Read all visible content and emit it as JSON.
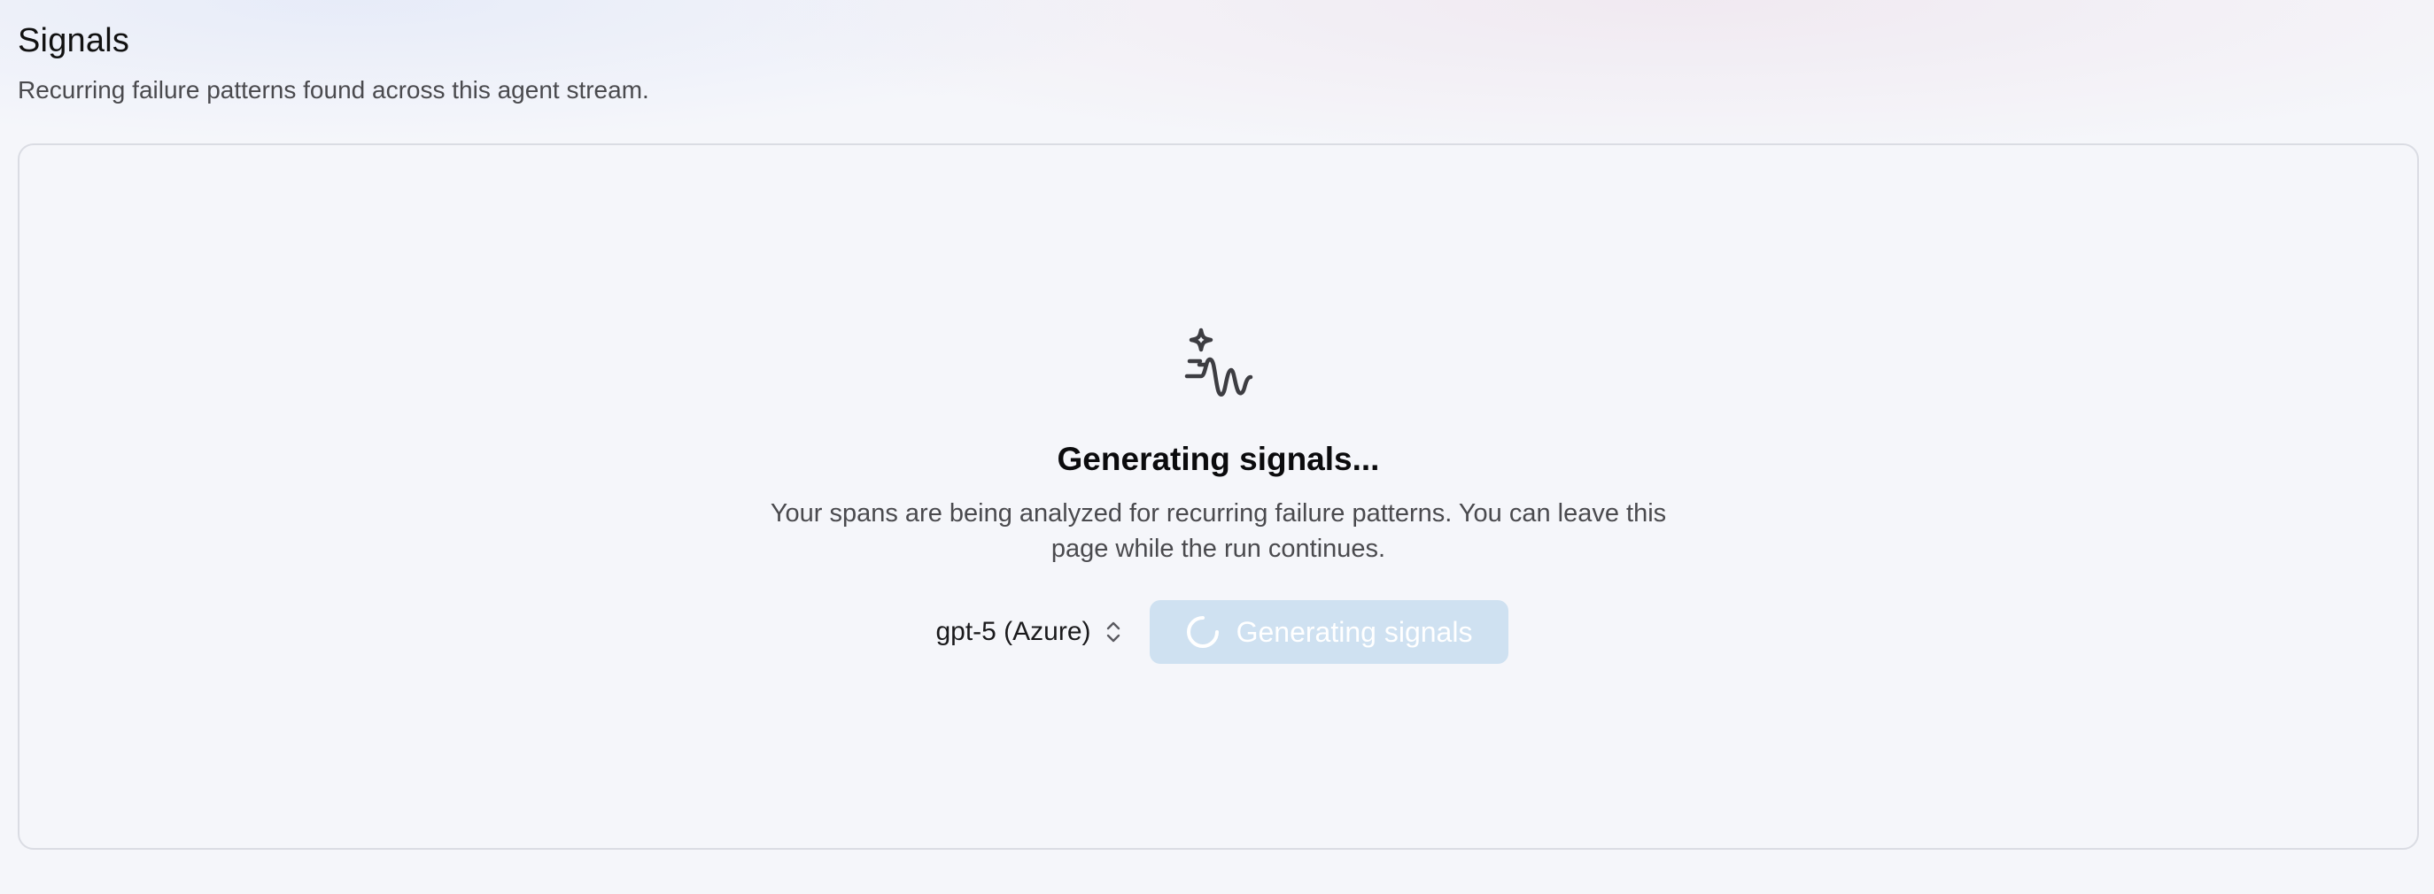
{
  "header": {
    "title": "Signals",
    "subtitle": "Recurring failure patterns found across this agent stream."
  },
  "empty_state": {
    "icon": "sparkle-wave-icon",
    "title": "Generating signals...",
    "description": "Your spans are being analyzed for recurring failure patterns. You can leave this page while the run continues."
  },
  "controls": {
    "model_select": {
      "selected": "gpt-5 (Azure)",
      "icon": "chevron-up-down-icon"
    },
    "generate_button": {
      "label": "Generating signals",
      "icon": "spinner-icon",
      "state": "disabled-loading"
    }
  },
  "colors": {
    "background": "#f5f6fa",
    "panel_border": "#dadce3",
    "button_bg": "#cfe1f1",
    "button_text": "#ffffff",
    "icon": "#3d3d42"
  }
}
